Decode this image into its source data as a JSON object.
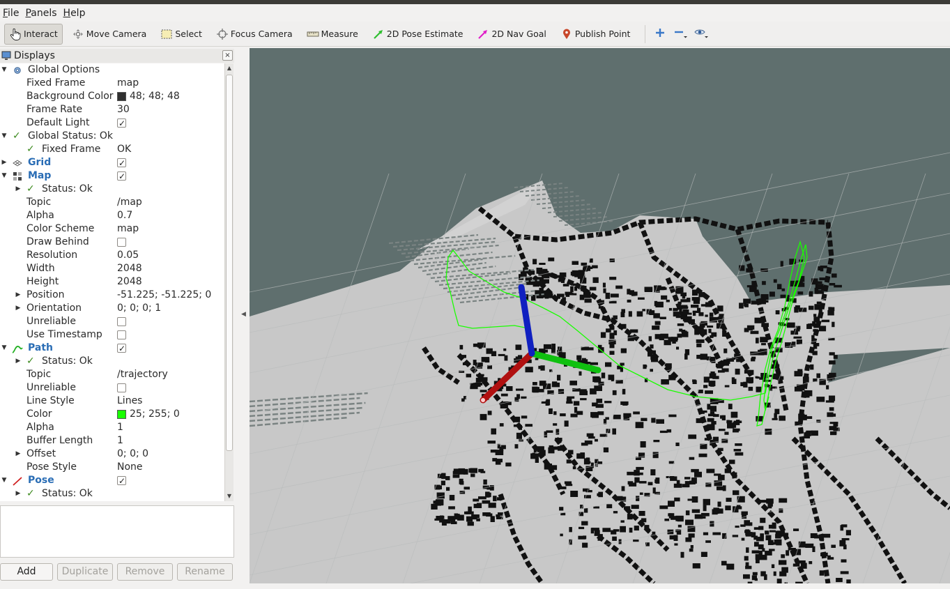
{
  "menubar": {
    "items": [
      {
        "label": "File",
        "mnemonic": "F",
        "rest": "ile"
      },
      {
        "label": "Panels",
        "mnemonic": "P",
        "rest": "anels"
      },
      {
        "label": "Help",
        "mnemonic": "H",
        "rest": "elp"
      }
    ]
  },
  "toolbar": {
    "interact": "Interact",
    "move_camera": "Move Camera",
    "select": "Select",
    "focus_camera": "Focus Camera",
    "measure": "Measure",
    "pose_estimate": "2D Pose Estimate",
    "nav_goal": "2D Nav Goal",
    "publish_point": "Publish Point",
    "active": "Interact"
  },
  "displays_panel": {
    "title": "Displays",
    "close": "×",
    "rows": [
      {
        "name": "Global Options",
        "value": "",
        "indent": 0,
        "arrow": "▼",
        "icon": "gear-icon",
        "type": "header"
      },
      {
        "name": "Fixed Frame",
        "value": "map",
        "indent": 1
      },
      {
        "name": "Background Color",
        "value": "48; 48; 48",
        "indent": 1,
        "swatch": "#303030"
      },
      {
        "name": "Frame Rate",
        "value": "30",
        "indent": 1
      },
      {
        "name": "Default Light",
        "value": "",
        "indent": 1,
        "checkbox": true
      },
      {
        "name": "Global Status: Ok",
        "value": "",
        "indent": 0,
        "arrow": "▼",
        "status": true
      },
      {
        "name": "Fixed Frame",
        "value": "OK",
        "indent": 1,
        "status": true
      },
      {
        "name": "Grid",
        "value": "",
        "indent": 0,
        "arrow": "▶",
        "icon": "grid-icon",
        "blue": true,
        "checkbox": true
      },
      {
        "name": "Map",
        "value": "",
        "indent": 0,
        "arrow": "▼",
        "icon": "map-icon",
        "blue": true,
        "checkbox": true
      },
      {
        "name": "Status: Ok",
        "value": "",
        "indent": 1,
        "arrow": "▶",
        "status": true
      },
      {
        "name": "Topic",
        "value": "/map",
        "indent": 1
      },
      {
        "name": "Alpha",
        "value": "0.7",
        "indent": 1
      },
      {
        "name": "Color Scheme",
        "value": "map",
        "indent": 1
      },
      {
        "name": "Draw Behind",
        "value": "",
        "indent": 1,
        "checkbox": false
      },
      {
        "name": "Resolution",
        "value": "0.05",
        "indent": 1
      },
      {
        "name": "Width",
        "value": "2048",
        "indent": 1
      },
      {
        "name": "Height",
        "value": "2048",
        "indent": 1
      },
      {
        "name": "Position",
        "value": "-51.225; -51.225; 0",
        "indent": 1,
        "arrow": "▶"
      },
      {
        "name": "Orientation",
        "value": "0; 0; 0; 1",
        "indent": 1,
        "arrow": "▶"
      },
      {
        "name": "Unreliable",
        "value": "",
        "indent": 1,
        "checkbox": false
      },
      {
        "name": "Use Timestamp",
        "value": "",
        "indent": 1,
        "checkbox": false
      },
      {
        "name": "Path",
        "value": "",
        "indent": 0,
        "arrow": "▼",
        "icon": "path-icon",
        "blue": true,
        "checkbox": true
      },
      {
        "name": "Status: Ok",
        "value": "",
        "indent": 1,
        "arrow": "▶",
        "status": true
      },
      {
        "name": "Topic",
        "value": "/trajectory",
        "indent": 1
      },
      {
        "name": "Unreliable",
        "value": "",
        "indent": 1,
        "checkbox": false
      },
      {
        "name": "Line Style",
        "value": "Lines",
        "indent": 1
      },
      {
        "name": "Color",
        "value": "25; 255; 0",
        "indent": 1,
        "swatch": "#19ff00"
      },
      {
        "name": "Alpha",
        "value": "1",
        "indent": 1
      },
      {
        "name": "Buffer Length",
        "value": "1",
        "indent": 1
      },
      {
        "name": "Offset",
        "value": "0; 0; 0",
        "indent": 1,
        "arrow": "▶"
      },
      {
        "name": "Pose Style",
        "value": "None",
        "indent": 1
      },
      {
        "name": "Pose",
        "value": "",
        "indent": 0,
        "arrow": "▼",
        "icon": "pose-icon",
        "blue": true,
        "checkbox": true
      },
      {
        "name": "Status: Ok",
        "value": "",
        "indent": 1,
        "arrow": "▶",
        "status": true
      }
    ],
    "buttons": {
      "add": "Add",
      "duplicate": "Duplicate",
      "remove": "Remove",
      "rename": "Rename"
    }
  },
  "colors": {
    "view_background": "#5f6f6e",
    "map_free": "#c8c8c8",
    "map_occupied": "#111111",
    "path": "#19ff00",
    "axis_x": "#b01010",
    "axis_y": "#10c010",
    "axis_z": "#1020c0"
  }
}
